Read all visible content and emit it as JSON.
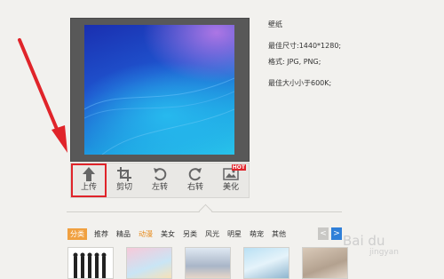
{
  "wallpaper_info": {
    "title": "壁纸",
    "best_size": "最佳尺寸:1440*1280;",
    "format": "格式: JPG, PNG;",
    "max_size": "最佳大小小于600K;"
  },
  "toolbar": {
    "items": [
      {
        "label": "上传",
        "icon": "upload-icon"
      },
      {
        "label": "剪切",
        "icon": "crop-icon"
      },
      {
        "label": "左转",
        "icon": "rotate-left-icon"
      },
      {
        "label": "右转",
        "icon": "rotate-right-icon"
      },
      {
        "label": "美化",
        "icon": "image-icon",
        "badge": "HOT"
      }
    ]
  },
  "categories": {
    "items": [
      "分类",
      "推荐",
      "精品",
      "动漫",
      "美女",
      "另类",
      "风光",
      "明星",
      "萌宠",
      "其他"
    ],
    "active_index": 0
  },
  "nav": {
    "prev": "<",
    "next": ">"
  },
  "watermark": {
    "logo": "Bai du",
    "sub": "jingyan"
  },
  "colors": {
    "accent_red": "#e0242a",
    "active_orange": "#f0a040",
    "nav_blue": "#2f7fd8"
  }
}
